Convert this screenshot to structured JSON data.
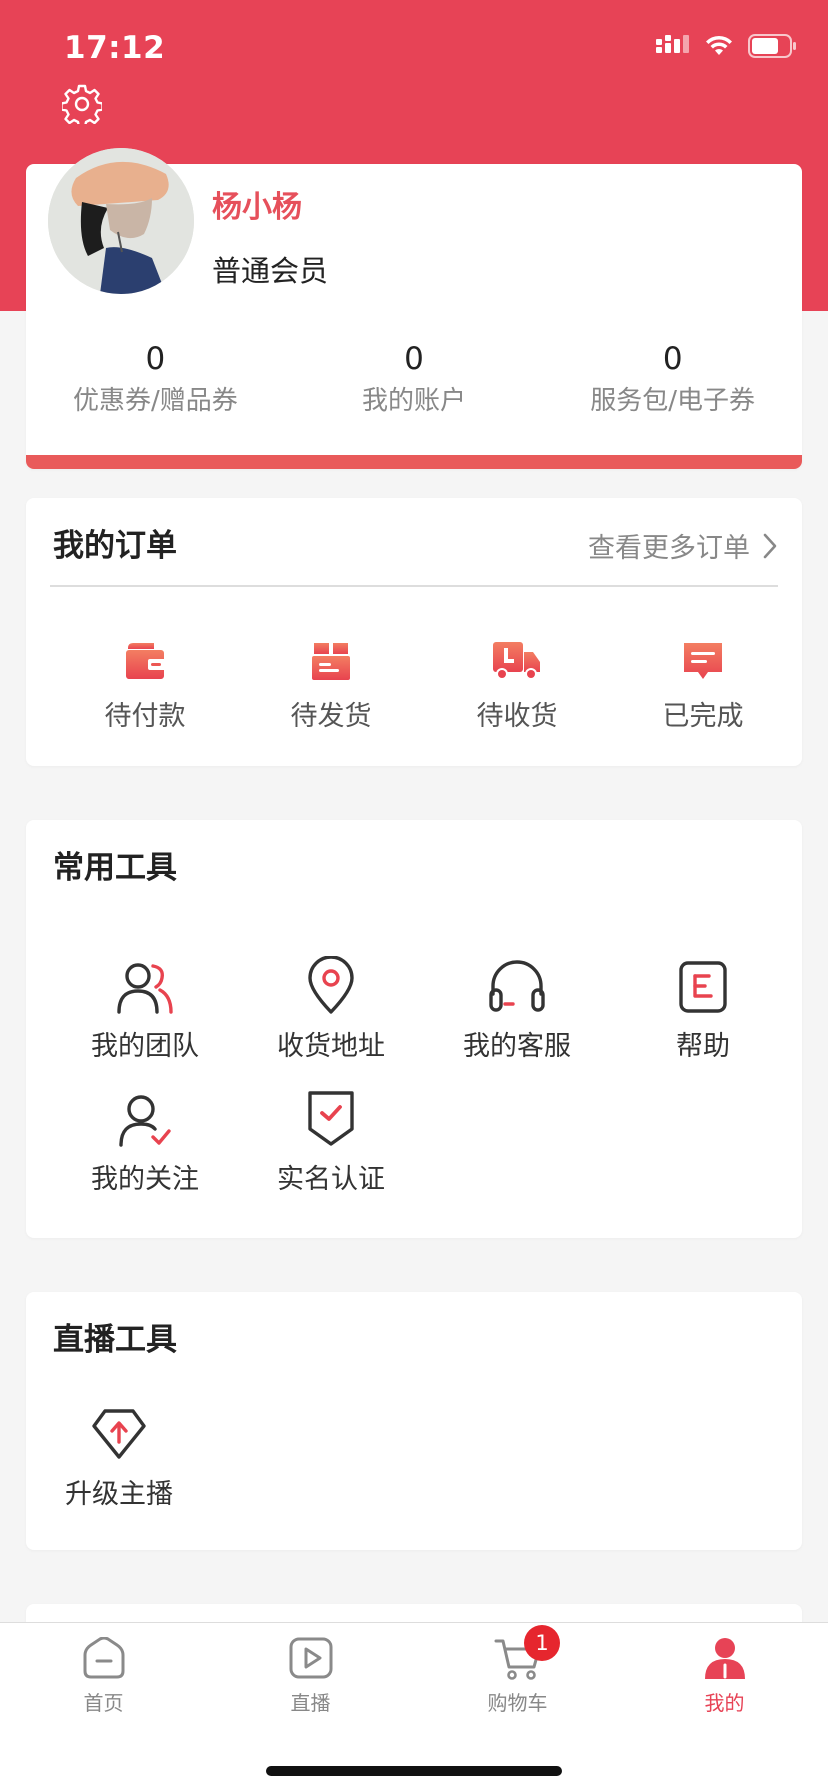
{
  "status_bar": {
    "time": "17:12"
  },
  "colors": {
    "brand": "#e74356",
    "accent_red": "#e6505b",
    "badge": "#e6262e"
  },
  "profile": {
    "name": "杨小杨",
    "level": "普通会员",
    "stats": [
      {
        "value": "0",
        "label": "优惠券/赠品券"
      },
      {
        "value": "0",
        "label": "我的账户"
      },
      {
        "value": "0",
        "label": "服务包/电子券"
      }
    ]
  },
  "orders": {
    "title": "我的订单",
    "more_label": "查看更多订单",
    "items": [
      {
        "label": "待付款",
        "icon": "wallet-icon"
      },
      {
        "label": "待发货",
        "icon": "box-icon"
      },
      {
        "label": "待收货",
        "icon": "truck-icon"
      },
      {
        "label": "已完成",
        "icon": "message-icon"
      }
    ]
  },
  "tools": {
    "title": "常用工具",
    "items": [
      {
        "label": "我的团队",
        "icon": "team-icon"
      },
      {
        "label": "收货地址",
        "icon": "location-icon"
      },
      {
        "label": "我的客服",
        "icon": "headset-icon"
      },
      {
        "label": "帮助",
        "icon": "help-icon"
      },
      {
        "label": "我的关注",
        "icon": "follow-icon"
      },
      {
        "label": "实名认证",
        "icon": "shield-check-icon"
      }
    ]
  },
  "live_tools": {
    "title": "直播工具",
    "items": [
      {
        "label": "升级主播",
        "icon": "upgrade-icon"
      }
    ]
  },
  "tabbar": {
    "items": [
      {
        "label": "首页",
        "icon": "home-icon"
      },
      {
        "label": "直播",
        "icon": "play-icon"
      },
      {
        "label": "购物车",
        "icon": "cart-icon",
        "badge": "1"
      },
      {
        "label": "我的",
        "icon": "profile-icon",
        "active": true
      }
    ]
  }
}
